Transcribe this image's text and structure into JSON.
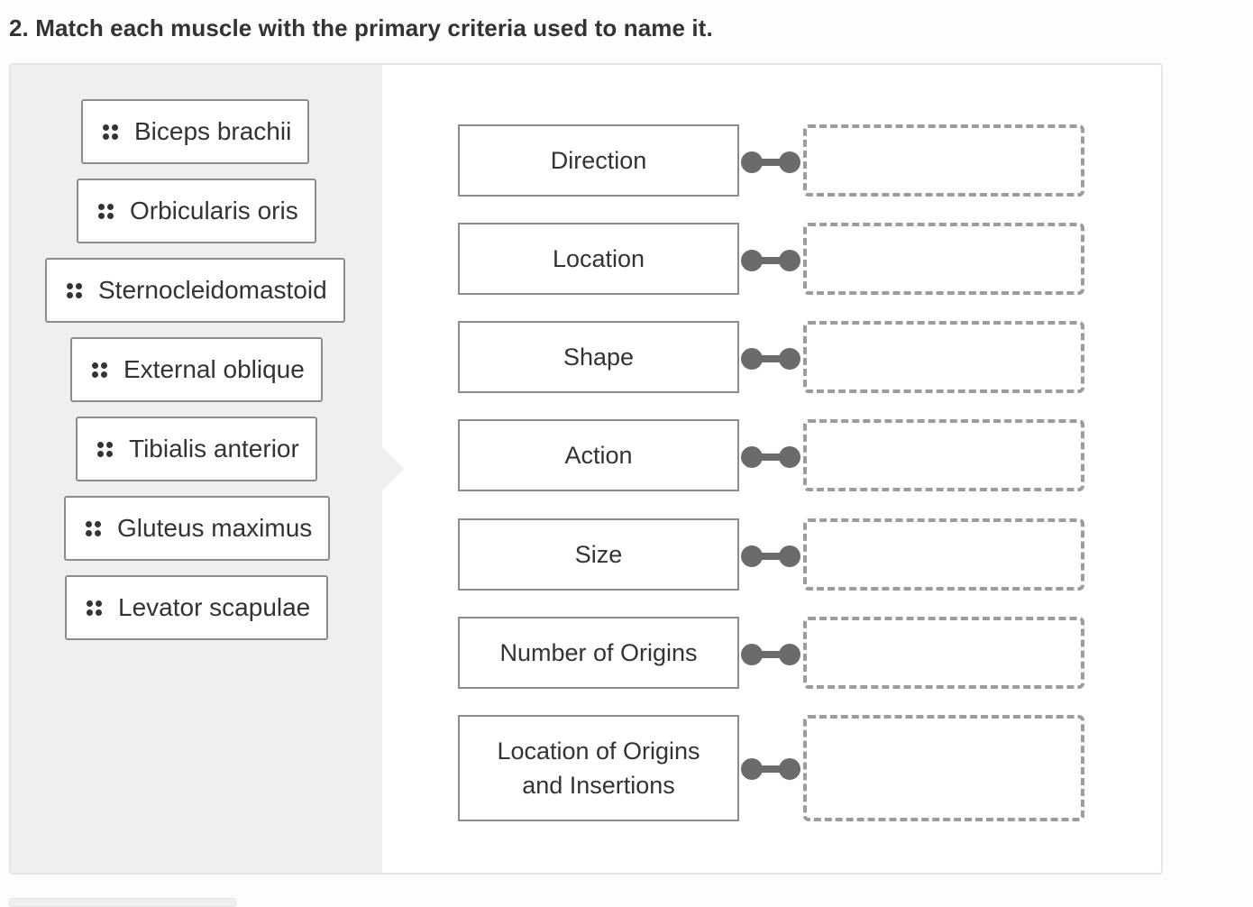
{
  "question": {
    "number": "2.",
    "title": "2. Match each muscle with the primary criteria used to name it."
  },
  "choices": [
    {
      "label": "Biceps brachii",
      "icon": "drag-handle-icon"
    },
    {
      "label": "Orbicularis oris",
      "icon": "drag-handle-icon"
    },
    {
      "label": "Sternocleidomastoid",
      "icon": "drag-handle-icon"
    },
    {
      "label": "External oblique",
      "icon": "drag-handle-icon"
    },
    {
      "label": "Tibialis anterior",
      "icon": "drag-handle-icon"
    },
    {
      "label": "Gluteus maximus",
      "icon": "drag-handle-icon"
    },
    {
      "label": "Levator scapulae",
      "icon": "drag-handle-icon"
    }
  ],
  "criteria": [
    {
      "label": "Direction",
      "match": ""
    },
    {
      "label": "Location",
      "match": ""
    },
    {
      "label": "Shape",
      "match": ""
    },
    {
      "label": "Action",
      "match": ""
    },
    {
      "label": "Size",
      "match": ""
    },
    {
      "label": "Number of Origins",
      "match": ""
    },
    {
      "label": "Location of Origins and Insertions",
      "match": ""
    }
  ],
  "colors": {
    "panel_bg": "#efefef",
    "border": "#8c8c8c",
    "dashed": "#9c9c9c",
    "connector": "#6b6b6b",
    "text": "#333333"
  }
}
